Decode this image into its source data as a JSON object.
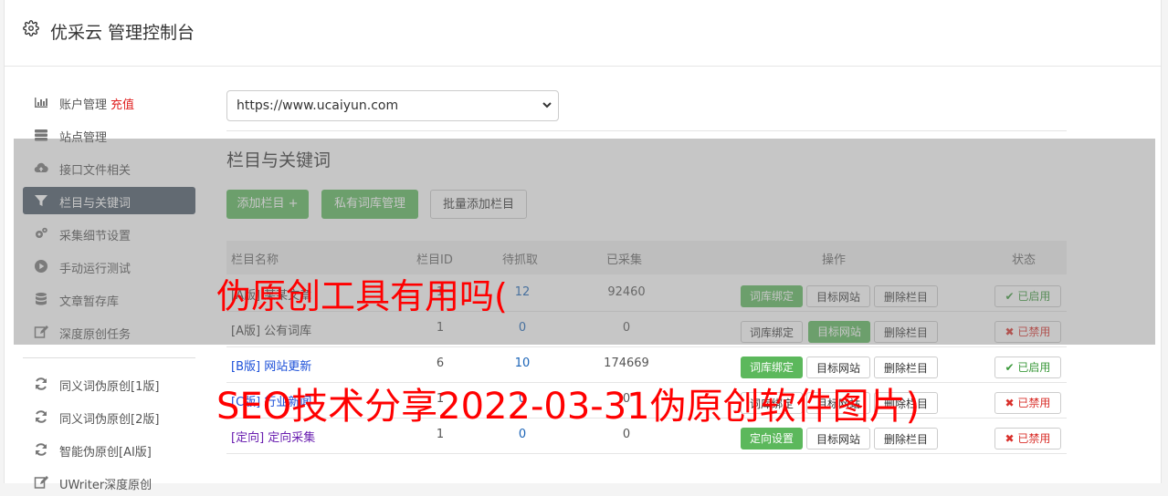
{
  "header": {
    "title": "优采云 管理控制台"
  },
  "sidebar": {
    "items": [
      {
        "label": "账户管理",
        "extra": "充值",
        "icon": "bar-chart-icon"
      },
      {
        "label": "站点管理",
        "icon": "server-icon"
      },
      {
        "label": "接口文件相关",
        "icon": "cloud-upload-icon"
      },
      {
        "label": "栏目与关键词",
        "icon": "filter-icon",
        "active": true
      },
      {
        "label": "采集细节设置",
        "icon": "cogs-icon"
      },
      {
        "label": "手动运行测试",
        "icon": "play-circle-icon"
      },
      {
        "label": "文章暂存库",
        "icon": "database-icon"
      },
      {
        "label": "深度原创任务",
        "icon": "edit-icon"
      }
    ],
    "items2": [
      {
        "label": "同义词伪原创[1版]",
        "icon": "refresh-icon"
      },
      {
        "label": "同义词伪原创[2版]",
        "icon": "refresh-icon"
      },
      {
        "label": "智能伪原创[AI版]",
        "icon": "refresh-icon"
      },
      {
        "label": "UWriter深度原创",
        "icon": "edit-icon"
      }
    ]
  },
  "site_select": {
    "value": "https://www.ucaiyun.com"
  },
  "section_title": "栏目与关键词",
  "actions": {
    "add_column": "添加栏目 +",
    "private_lib": "私有词库管理",
    "batch_add": "批量添加栏目"
  },
  "table": {
    "headers": {
      "name": "栏目名称",
      "id": "栏目ID",
      "pending": "待抓取",
      "collected": "已采集",
      "ops": "操作",
      "status": "状态"
    },
    "rows": [
      {
        "name": "[A版] 某某文章",
        "id": "1",
        "pending": "12",
        "collected": "92460",
        "op1": "词库绑定",
        "op1_green": true,
        "op2": "目标网站",
        "op2_green": false,
        "op3": "删除栏目",
        "status": "已启用",
        "enabled": true
      },
      {
        "name": "[A版] 公有词库",
        "id": "1",
        "pending": "0",
        "collected": "0",
        "op1": "词库绑定",
        "op1_green": false,
        "op2": "目标网站",
        "op2_green": true,
        "op3": "删除栏目",
        "status": "已禁用",
        "enabled": false
      },
      {
        "name": "[B版] 网站更新",
        "id": "6",
        "pending": "10",
        "collected": "174669",
        "op1": "词库绑定",
        "op1_green": true,
        "op2": "目标网站",
        "op2_green": false,
        "op3": "删除栏目",
        "status": "已启用",
        "enabled": true
      },
      {
        "name": "[C版] 行业新闻",
        "id": "1",
        "pending": "0",
        "collected": "0",
        "op1": "词库绑定",
        "op1_green": false,
        "op2": "目标网站",
        "op2_green": false,
        "op3": "删除栏目",
        "status": "已禁用",
        "enabled": false
      },
      {
        "name": "[定向] 定向采集",
        "id": "1",
        "pending": "0",
        "collected": "0",
        "op1": "定向设置",
        "op1_green": true,
        "op2": "目标网站",
        "op2_green": false,
        "op3": "删除栏目",
        "status": "已禁用",
        "enabled": false
      }
    ]
  },
  "watermark": {
    "line1": "伪原创工具有用吗(",
    "line2": "SEO技术分享2022-03-31伪原创软件图片)"
  },
  "colors": {
    "accent_green": "#5cb85c",
    "active_sidebar": "#4a5866",
    "watermark_red": "#ff0000",
    "link_blue": "#1b64b7"
  }
}
